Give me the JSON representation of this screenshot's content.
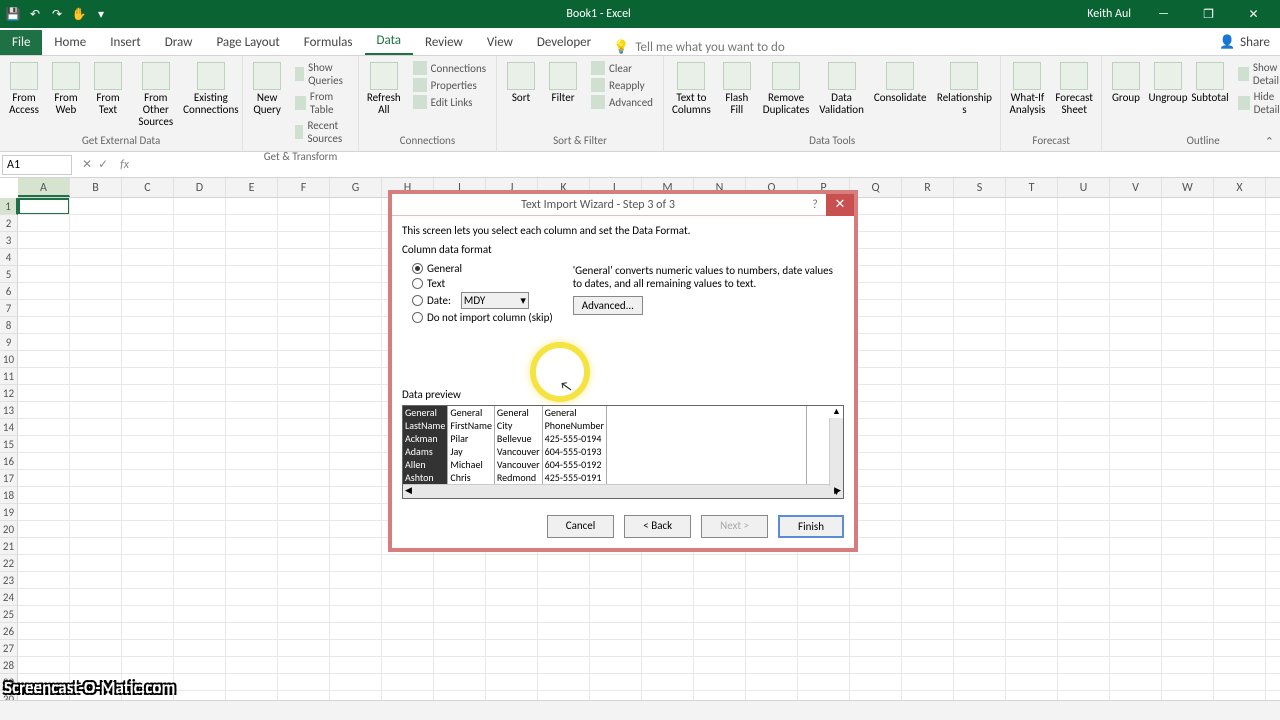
{
  "titlebar": {
    "title": "Book1 - Excel",
    "user": "Keith Aul"
  },
  "menu": {
    "file": "File",
    "tabs": [
      "Home",
      "Insert",
      "Draw",
      "Page Layout",
      "Formulas",
      "Data",
      "Review",
      "View",
      "Developer"
    ],
    "active": "Data",
    "tell_me": "Tell me what you want to do",
    "share": "Share"
  },
  "ribbon": {
    "groups": [
      {
        "name": "Get External Data",
        "big": [
          "From\nAccess",
          "From\nWeb",
          "From\nText",
          "From Other\nSources",
          "Existing\nConnections"
        ]
      },
      {
        "name": "Get & Transform",
        "big": [
          "New\nQuery"
        ],
        "mini": [
          "Show Queries",
          "From Table",
          "Recent Sources"
        ]
      },
      {
        "name": "Connections",
        "big": [
          "Refresh\nAll"
        ],
        "mini": [
          "Connections",
          "Properties",
          "Edit Links"
        ]
      },
      {
        "name": "Sort & Filter",
        "big": [
          "Sort",
          "Filter"
        ],
        "mini": [
          "Clear",
          "Reapply",
          "Advanced"
        ]
      },
      {
        "name": "Data Tools",
        "big": [
          "Text to\nColumns",
          "Flash\nFill",
          "Remove\nDuplicates",
          "Data\nValidation",
          "Consolidate",
          "Relationships"
        ]
      },
      {
        "name": "Forecast",
        "big": [
          "What-If\nAnalysis",
          "Forecast\nSheet"
        ]
      },
      {
        "name": "Outline",
        "big": [
          "Group",
          "Ungroup",
          "Subtotal"
        ],
        "mini": [
          "Show Detail",
          "Hide Detail"
        ]
      }
    ]
  },
  "namebox": "A1",
  "columns": [
    "A",
    "B",
    "C",
    "D",
    "E",
    "F",
    "G",
    "H",
    "I",
    "J",
    "K",
    "L",
    "M",
    "N",
    "O",
    "P",
    "Q",
    "R",
    "S",
    "T",
    "U",
    "V",
    "W",
    "X"
  ],
  "dialog": {
    "title": "Text Import Wizard - Step 3 of 3",
    "instruction": "This screen lets you select each column and set the Data Format.",
    "fieldset": "Column data format",
    "options": {
      "general": "General",
      "text": "Text",
      "date": "Date:",
      "date_val": "MDY",
      "skip": "Do not import column (skip)"
    },
    "hint": "'General' converts numeric values to numbers, date values to dates, and all remaining values to text.",
    "advanced": "Advanced...",
    "preview_label": "Data preview",
    "col_headers": [
      "General",
      "General",
      "General",
      "General"
    ],
    "rows": [
      [
        "LastName",
        "FirstName",
        "City",
        "PhoneNumber"
      ],
      [
        "Ackman",
        "Pilar",
        "Bellevue",
        "425-555-0194"
      ],
      [
        "Adams",
        "Jay",
        "Vancouver",
        "604-555-0193"
      ],
      [
        "Allen",
        "Michael",
        "Vancouver",
        "604-555-0192"
      ],
      [
        "Ashton",
        "Chris",
        "Redmond",
        "425-555-0191"
      ]
    ],
    "buttons": {
      "cancel": "Cancel",
      "back": "< Back",
      "next": "Next >",
      "finish": "Finish"
    }
  },
  "watermark": "Screencast-O-Matic.com"
}
